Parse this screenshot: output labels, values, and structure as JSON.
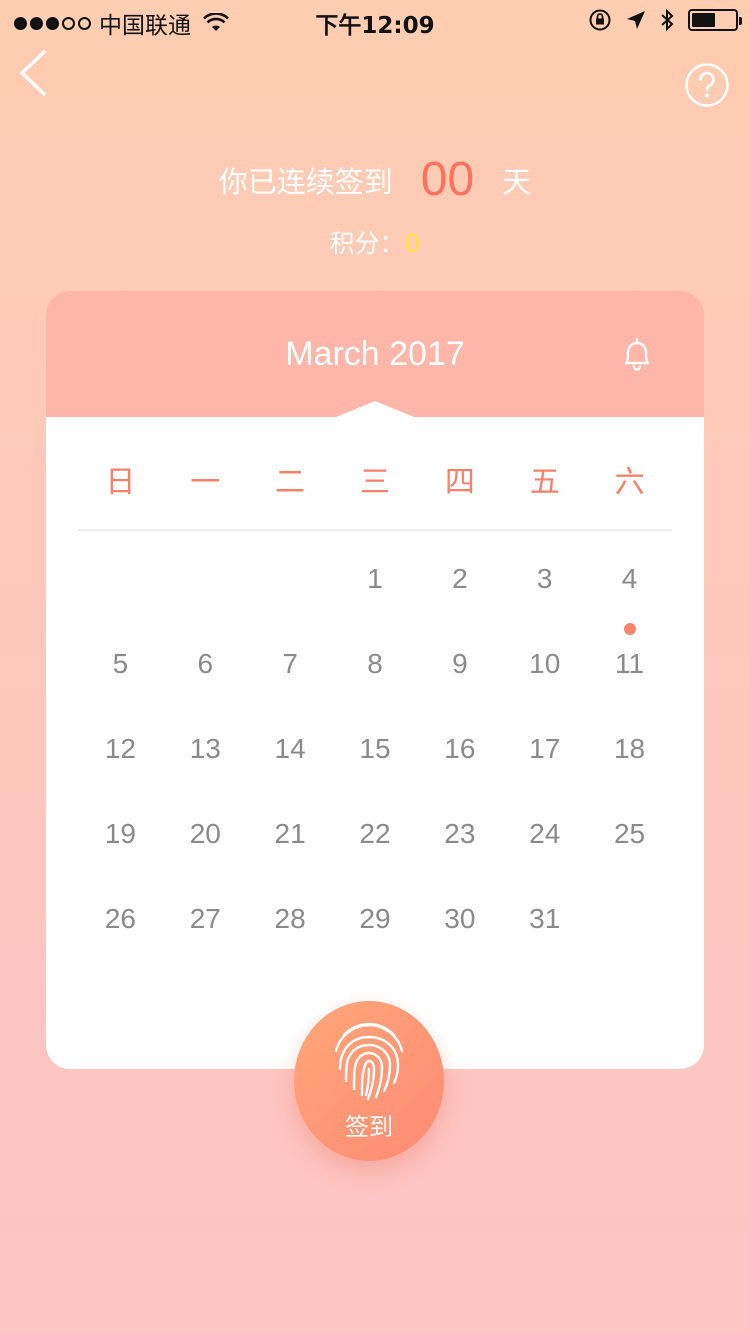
{
  "status_bar": {
    "carrier": "中国联通",
    "time": "下午12:09",
    "battery_level": 0.55
  },
  "streak": {
    "prefix": "你已连续签到",
    "count": "00",
    "suffix": "天"
  },
  "points": {
    "label": "积分：",
    "value": "0"
  },
  "calendar": {
    "month_title": "March 2017",
    "weekdays": [
      "日",
      "一",
      "二",
      "三",
      "四",
      "五",
      "六"
    ],
    "leading_blanks": 3,
    "days": [
      "1",
      "2",
      "3",
      "4",
      "5",
      "6",
      "7",
      "8",
      "9",
      "10",
      "11",
      "12",
      "13",
      "14",
      "15",
      "16",
      "17",
      "18",
      "19",
      "20",
      "21",
      "22",
      "23",
      "24",
      "25",
      "26",
      "27",
      "28",
      "29",
      "30",
      "31"
    ],
    "marked_day": "4"
  },
  "signin_button": {
    "label": "签到"
  },
  "colors": {
    "accent": "#f9735f",
    "header": "#fdb6a8",
    "points_value": "#ffe23d",
    "day_text": "#8a8a8a"
  },
  "icons": [
    "back-chevron-icon",
    "help-icon",
    "bell-icon",
    "fingerprint-icon",
    "wifi-icon",
    "lock-rotation-icon",
    "location-arrow-icon",
    "bluetooth-icon",
    "battery-icon"
  ]
}
